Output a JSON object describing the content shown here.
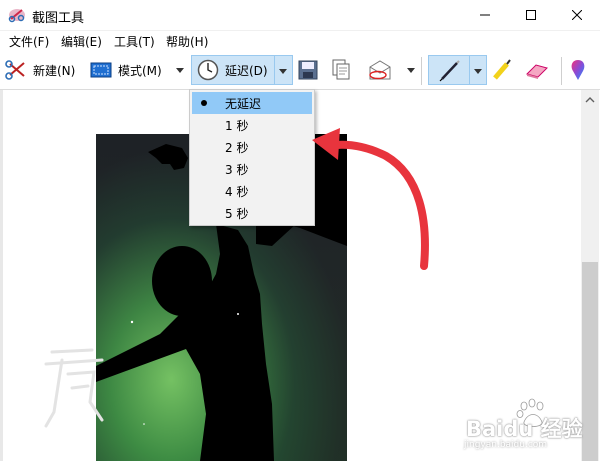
{
  "window": {
    "title": "截图工具"
  },
  "titlebar_controls": {
    "minimize": "—",
    "maximize": "☐",
    "close": "✕"
  },
  "menu": {
    "items": [
      "文件(F)",
      "编辑(E)",
      "工具(T)",
      "帮助(H)"
    ]
  },
  "toolbar": {
    "new_label": "新建(N)",
    "mode_label": "模式(M)",
    "delay_label": "延迟(D)",
    "icons": [
      "new-scissors-icon",
      "mode-rect-icon",
      "clock-icon",
      "save-icon",
      "copy-icon",
      "send-mail-icon",
      "pen-icon",
      "highlighter-icon",
      "eraser-icon",
      "paint3d-icon"
    ]
  },
  "delay_menu": {
    "selected_index": 0,
    "options": [
      "无延迟",
      "1 秒",
      "2 秒",
      "3 秒",
      "4 秒",
      "5 秒"
    ]
  },
  "watermark": {
    "text": "Baidu 经验",
    "url": "jingyan.baidu.com"
  },
  "colors": {
    "selection_blue": "#cce4f7",
    "menu_highlight": "#91c9f7",
    "annotation_red": "#e8343d"
  }
}
